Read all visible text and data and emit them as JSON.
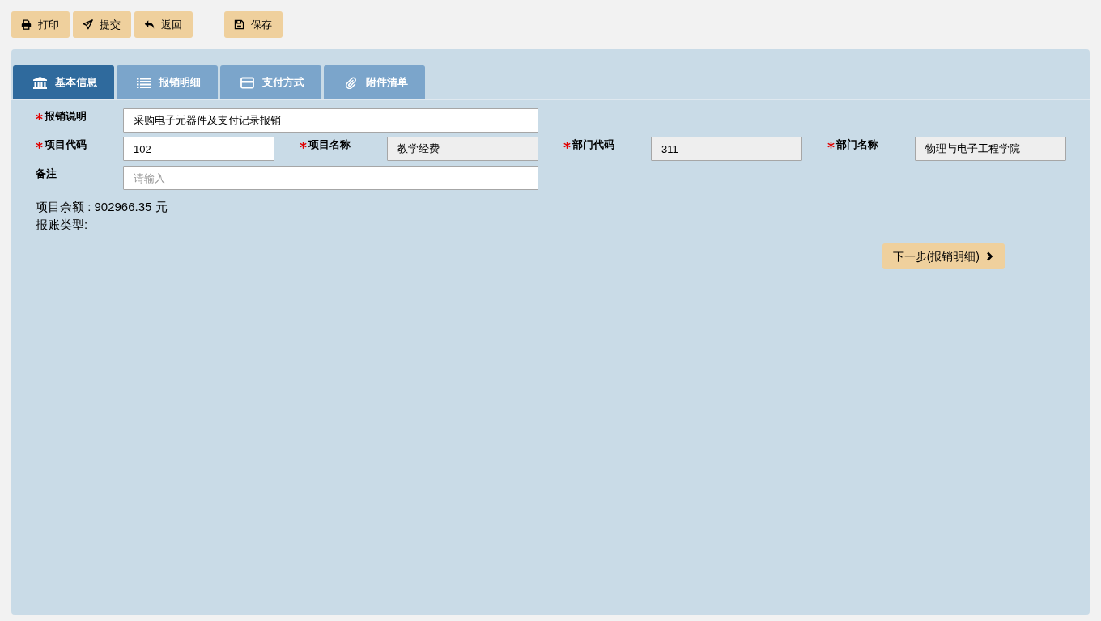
{
  "toolbar": {
    "groups": [
      [
        {
          "kind": "print",
          "label": "打印"
        },
        {
          "kind": "submit",
          "label": "提交"
        },
        {
          "kind": "back",
          "label": "返回"
        }
      ],
      [
        {
          "kind": "save",
          "label": "保存"
        }
      ]
    ]
  },
  "tabs": [
    {
      "kind": "bank",
      "label": "基本信息",
      "selected": true
    },
    {
      "kind": "list",
      "label": "报销明细",
      "selected": false
    },
    {
      "kind": "card",
      "label": "支付方式",
      "selected": false
    },
    {
      "kind": "paperclip",
      "label": "附件清单",
      "selected": false
    }
  ],
  "form": {
    "rows": [
      [
        {
          "label": "报销说明",
          "required": true,
          "value": "采购电子元器件及支付记录报销",
          "readonly": false
        }
      ],
      [
        {
          "label": "项目代码",
          "required": true,
          "value": "102",
          "readonly": false
        },
        {
          "label": "项目名称",
          "required": true,
          "value": "教学经费",
          "readonly": true
        },
        {
          "label": "部门代码",
          "required": true,
          "value": "311",
          "readonly": true
        },
        {
          "label": "部门名称",
          "required": true,
          "value": "物理与电子工程学院",
          "readonly": true
        }
      ],
      [
        {
          "label": "备注",
          "required": false,
          "placeholder": "请输入",
          "readonly": false
        }
      ]
    ]
  },
  "summary": [
    "项目余额 : 902966.35 元",
    "报账类型:"
  ],
  "next_button": {
    "label": "下一步(报销明细)"
  }
}
